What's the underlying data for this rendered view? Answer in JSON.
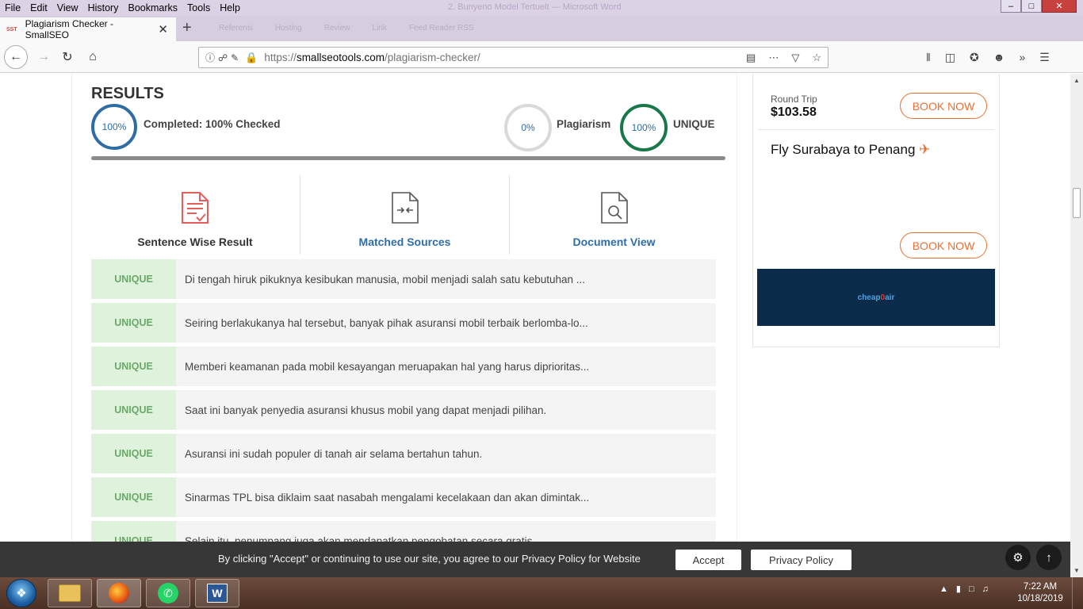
{
  "menubar": {
    "items": [
      "File",
      "Edit",
      "View",
      "History",
      "Bookmarks",
      "Tools",
      "Help"
    ],
    "window_title_faded": "2. Bunyeno Model Tertuelt — Microsoft Word"
  },
  "browser": {
    "tab": {
      "favicon_text": "SST",
      "title": "Plagiarism Checker - SmallSEO"
    },
    "bookmarks_faded": [
      "Referensi",
      "Hosting",
      "Review",
      "Lirik",
      "Feed Reader RSS"
    ],
    "url": {
      "protocol": "https://",
      "host": "smallseotools.com",
      "path": "/plagiarism-checker/"
    }
  },
  "results": {
    "title": "RESULTS",
    "completed_circle": "100%",
    "completed_label": "Completed: 100% Checked",
    "completed_fraction": 1.0,
    "plagiarism_circle": "0%",
    "plagiarism_label": "Plagiarism",
    "unique_circle": "100%",
    "unique_label": "UNIQUE"
  },
  "result_tabs": [
    {
      "label": "Sentence Wise Result",
      "icon": "document-check-icon"
    },
    {
      "label": "Matched Sources",
      "icon": "document-compare-icon"
    },
    {
      "label": "Document View",
      "icon": "document-search-icon"
    }
  ],
  "sentences": [
    {
      "status": "UNIQUE",
      "text": "Di tengah hiruk pikuknya kesibukan manusia, mobil menjadi salah satu kebutuhan ..."
    },
    {
      "status": "UNIQUE",
      "text": "Seiring berlakukanya hal tersebut, banyak pihak asuransi mobil terbaik berlomba-lo..."
    },
    {
      "status": "UNIQUE",
      "text": "Memberi keamanan pada mobil kesayangan meruapakan hal yang harus diprioritas..."
    },
    {
      "status": "UNIQUE",
      "text": "Saat ini banyak penyedia asuransi khusus mobil yang dapat menjadi pilihan."
    },
    {
      "status": "UNIQUE",
      "text": "Asuransi ini sudah populer di tanah air selama bertahun tahun."
    },
    {
      "status": "UNIQUE",
      "text": "Sinarmas TPL bisa diklaim saat nasabah mengalami kecelakaan dan akan dimintak..."
    },
    {
      "status": "UNIQUE",
      "text": "Selain itu, penumpang juga akan mendapatkan pengobatan secara gratis."
    }
  ],
  "ad": {
    "trip_type": "Round Trip",
    "price": "$103.58",
    "book_label": "BOOK NOW",
    "route": "Fly Surabaya to Penang",
    "logo_prefix": "cheap",
    "logo_o": "0",
    "logo_suffix": "air"
  },
  "cookie": {
    "text": "By clicking \"Accept\" or continuing to use our site, you agree to our Privacy Policy for Website",
    "accept": "Accept",
    "privacy": "Privacy Policy"
  },
  "taskbar": {
    "time": "7:22 AM",
    "date": "10/18/2019",
    "word_label": "W"
  },
  "colors": {
    "accent_blue": "#2f6ca8",
    "unique_green": "#19784a",
    "ad_orange": "#e97032",
    "badge_bg": "#dff3dc"
  }
}
